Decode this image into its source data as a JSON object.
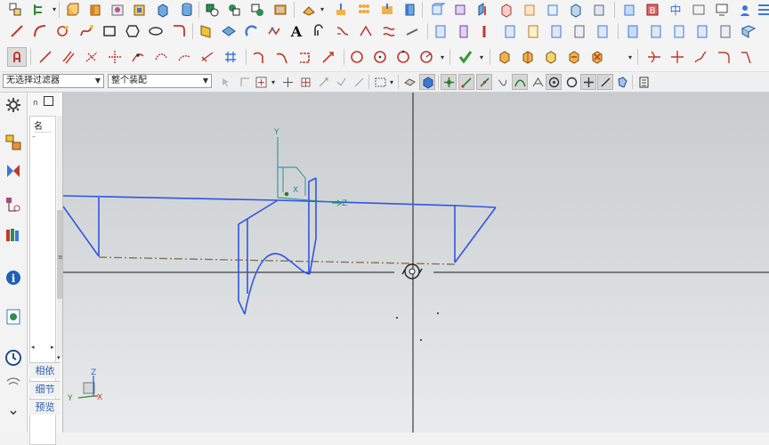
{
  "selection_bar": {
    "filter_combo": "无选择过滤器",
    "scope_combo": "整个装配"
  },
  "navigator": {
    "column_header": "名",
    "sections": [
      "相依",
      "细节",
      "预览"
    ]
  },
  "wcs_axes": {
    "x": "X",
    "y": "Y",
    "z": "Z"
  },
  "triad_axes": {
    "x": "X",
    "y": "Y",
    "z": "Z"
  },
  "colors": {
    "curve": "#3156e0",
    "dashed_line": "#7c6f4a",
    "crosshair": "#1a1a1a",
    "wcs_z_axis": "#1f8c8c",
    "background_top": "#c9cccf",
    "background_bottom": "#e9ebec"
  },
  "icons": {
    "row1": [
      "assembly-icon",
      "tree-icon",
      "extrude-icon",
      "revolve-icon",
      "hole-icon",
      "shell-icon",
      "cylinder-icon",
      "block-icon",
      "trim-body-icon",
      "unite-icon",
      "subtract-icon",
      "pattern-icon",
      "sweep-icon",
      "mesh-icon",
      "patch-icon",
      "face-icon",
      "blend-icon",
      "thicken-icon",
      "sew-icon",
      "offset-face-icon",
      "cube-view-icon",
      "shaded-icon",
      "wireframe-icon",
      "section-icon",
      "help-icon",
      "window-icon"
    ],
    "row2": [
      "line-icon",
      "arc-icon",
      "circle-point-icon",
      "spline-icon",
      "rectangle-icon",
      "polygon-icon",
      "ellipse-icon",
      "fillet-curve-icon",
      "helix-icon",
      "surface-grid-icon",
      "law-curve-icon",
      "curve-text-icon",
      "text-icon",
      "offset-curve-icon",
      "bridge-curve-icon",
      "divide-curve-icon",
      "project-curve-icon",
      "intersection-icon"
    ],
    "row3": [
      "associative-icon",
      "line-constraint-icon",
      "parallel-icon",
      "perpendicular-icon",
      "tangent-icon",
      "point-on-curve-icon",
      "distance-icon",
      "angle-icon",
      "grid-icon",
      "arc-tool-icon",
      "fillet-tool-icon",
      "chamfer-tool-icon",
      "trim-tool-icon",
      "circle-tool-icon",
      "circle-center-icon",
      "circle-tangent-icon",
      "radius-icon",
      "check-icon",
      "part-icon",
      "body-icon",
      "sheet-icon",
      "edit-icon",
      "trim-curve-icon",
      "extend-curve-icon",
      "corner-icon",
      "mirror-curve-icon"
    ]
  }
}
